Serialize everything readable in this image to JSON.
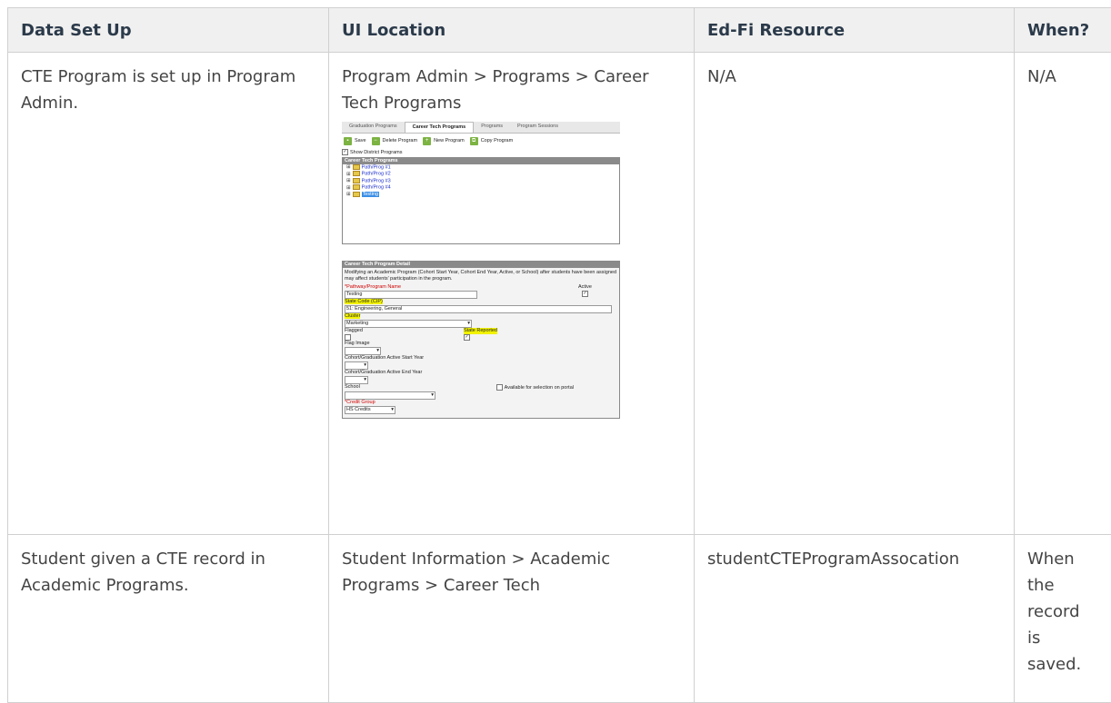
{
  "table": {
    "headers": [
      "Data Set Up",
      "UI Location",
      "Ed-Fi Resource",
      "When?"
    ],
    "rows": [
      {
        "data_set_up": "CTE Program is set up in Program Admin.",
        "ui_location": "Program Admin > Programs > Career Tech Programs",
        "edfi_resource": "N/A",
        "when": "N/A"
      },
      {
        "data_set_up": "Student given a CTE record in Academic Programs.",
        "ui_location": "Student Information > Academic Programs > Career Tech",
        "edfi_resource": "studentCTEProgramAssocation",
        "when": "When the record is saved."
      }
    ]
  },
  "screenshot": {
    "tabs": [
      "Graduation Programs",
      "Career Tech Programs",
      "Programs",
      "Program Sessions"
    ],
    "toolbar": [
      "Save",
      "Delete Program",
      "New Program",
      "Copy Program"
    ],
    "show_district": "Show District Programs",
    "tree_header": "Career Tech Programs",
    "tree_items": [
      "Path/Prog #1",
      "Path/Prog #2",
      "Path/Prog #3",
      "Path/Prog #4",
      "Testing"
    ],
    "detail_header": "Career Tech Program Detail",
    "detail_note": "Modifying an Academic Program (Cohort Start Year, Cohort End Year, Active, or School) after students have been assigned may affect students' participation in the program.",
    "name_label": "*Pathway/Program Name",
    "name_value": "Testing",
    "active_label": "Active",
    "state_code_label": "State Code (CIP)",
    "state_code_value": "51: Engineering, General",
    "cluster_label": "Cluster",
    "cluster_value": "Marketing",
    "flagged_label": "Flagged",
    "state_reported_label": "State Reported",
    "flag_image_label": "Flag Image",
    "cohort_start_label": "Cohort/Graduation Active Start Year",
    "cohort_end_label": "Cohort/Graduation Active End Year",
    "school_label": "School",
    "portal_label": "Available for selection on portal",
    "credit_group_label": "*Credit Group",
    "credit_group_value": "HS Credits"
  }
}
